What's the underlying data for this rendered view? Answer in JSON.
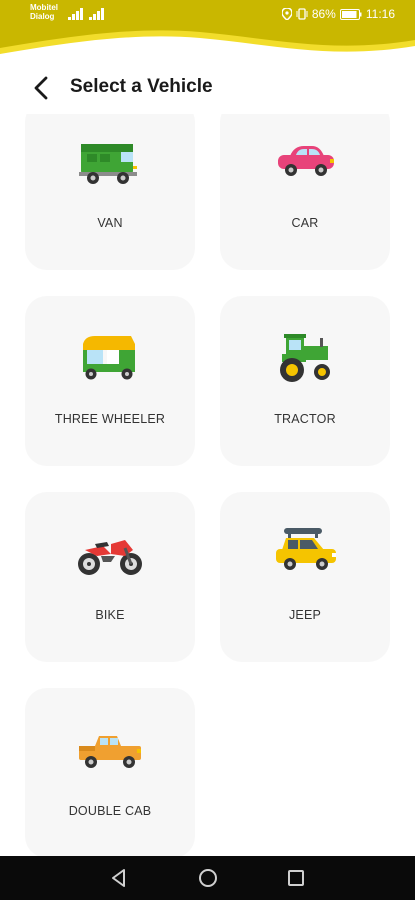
{
  "status_bar": {
    "carrier_line1": "Mobitel",
    "carrier_line2": "Dialog",
    "battery": "86%",
    "time": "11:16",
    "color": "#c9b700"
  },
  "header": {
    "title": "Select a Vehicle",
    "back_icon": "back-arrow-icon"
  },
  "vehicles": [
    {
      "label": "VAN",
      "icon": "van-icon",
      "color": "#3fa535"
    },
    {
      "label": "CAR",
      "icon": "car-icon",
      "color": "#e8437a"
    },
    {
      "label": "THREE WHEELER",
      "icon": "three-wheeler-icon",
      "color": "#f5b800"
    },
    {
      "label": "TRACTOR",
      "icon": "tractor-icon",
      "color": "#3fa535"
    },
    {
      "label": "BIKE",
      "icon": "bike-icon",
      "color": "#e53935"
    },
    {
      "label": "JEEP",
      "icon": "jeep-icon",
      "color": "#f5c400"
    },
    {
      "label": "DOUBLE CAB",
      "icon": "double-cab-icon",
      "color": "#f0a030"
    }
  ],
  "nav_bar": {
    "back": "nav-back-icon",
    "home": "nav-home-icon",
    "recents": "nav-recents-icon"
  }
}
